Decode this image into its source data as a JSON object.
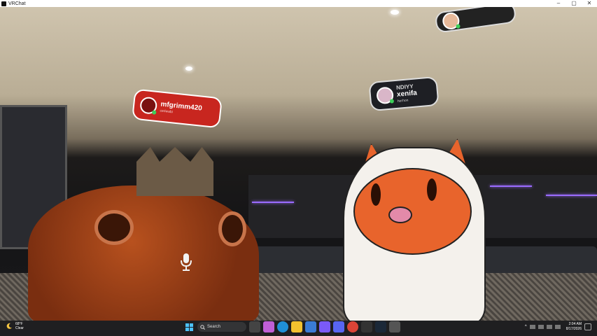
{
  "window": {
    "title": "VRChat",
    "min_glyph": "–",
    "max_glyph": "▢",
    "close_glyph": "✕"
  },
  "nameplates": [
    {
      "name": "mfgrimm420",
      "subtitle": "ceriwabi"
    },
    {
      "name": "xenifa",
      "subtitle": "herhon",
      "banner": "NDIYY"
    }
  ],
  "taskbar": {
    "weather_temp": "68°F",
    "weather_cond": "Clear",
    "search_placeholder": "Search",
    "time": "2:04 AM",
    "date": "8/17/2026"
  },
  "colors": {
    "nameplate_red": "#c8261f",
    "online_green": "#3ecf5a",
    "neon_purple": "#9a6bff"
  }
}
